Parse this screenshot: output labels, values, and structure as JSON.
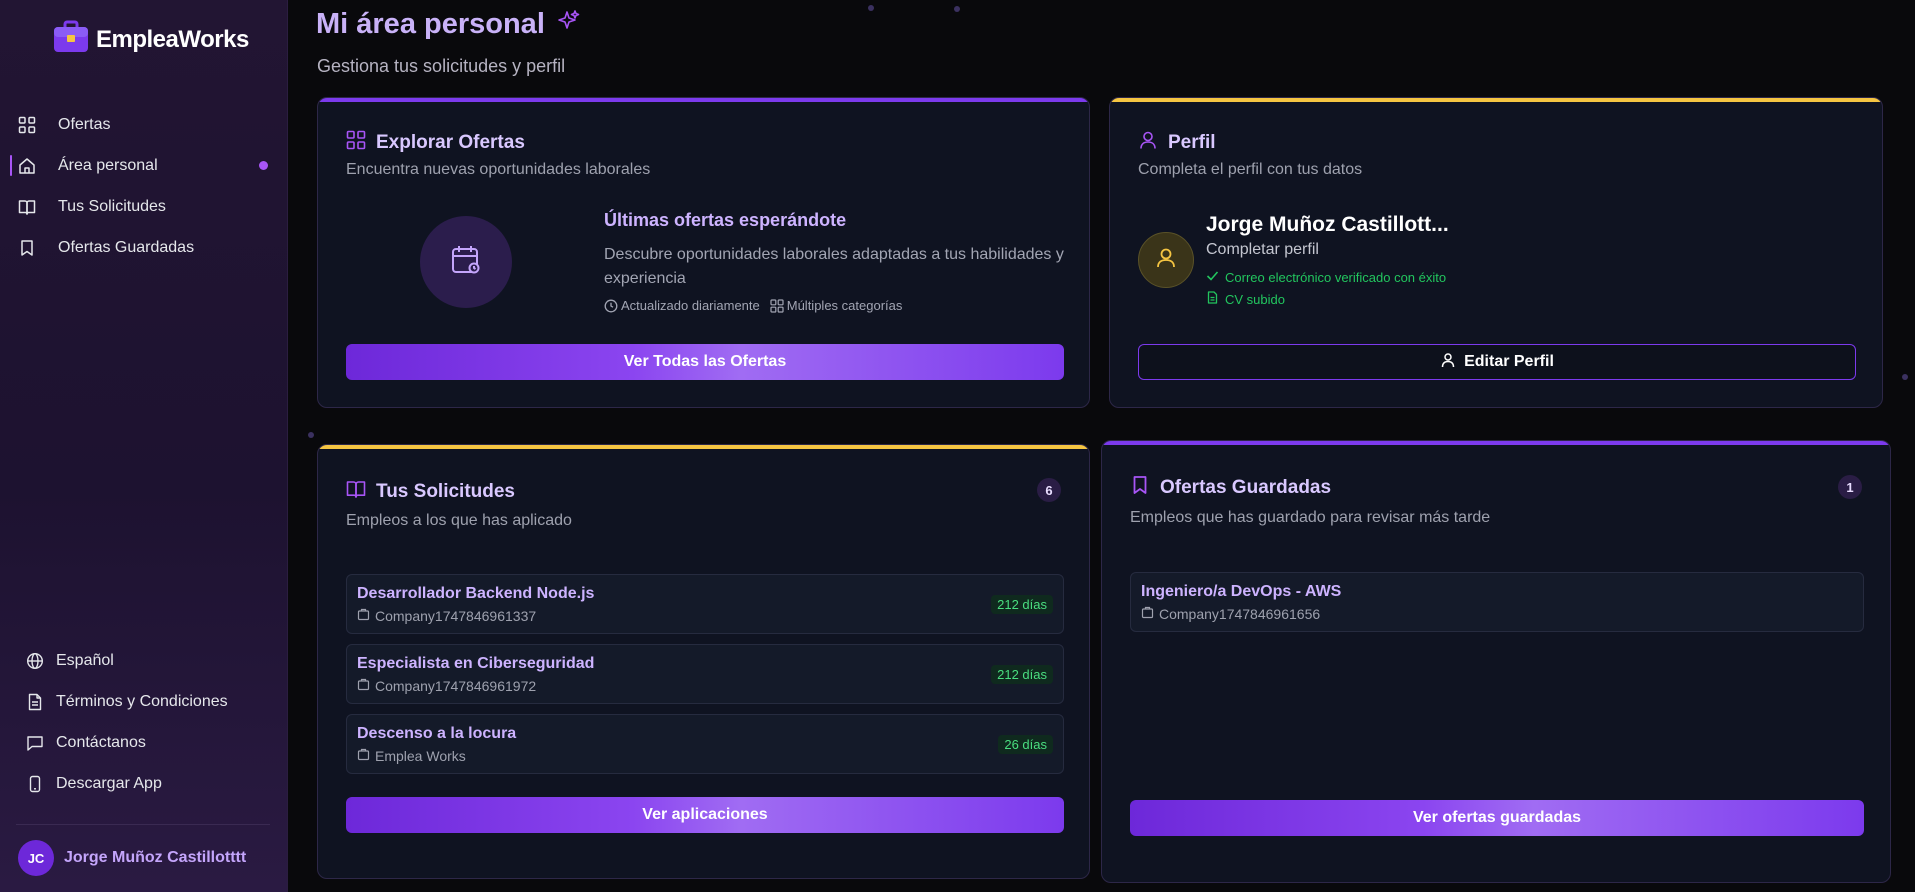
{
  "app": {
    "name": "EmpleaWorks"
  },
  "sidebar": {
    "items": [
      {
        "label": "Ofertas",
        "icon": "grid-icon",
        "active": false
      },
      {
        "label": "Área personal",
        "icon": "home-icon",
        "active": true
      },
      {
        "label": "Tus Solicitudes",
        "icon": "book-icon",
        "active": false
      },
      {
        "label": "Ofertas Guardadas",
        "icon": "bookmark-icon",
        "active": false
      }
    ],
    "bottom": [
      {
        "label": "Español",
        "icon": "globe-icon"
      },
      {
        "label": "Términos y Condiciones",
        "icon": "document-icon"
      },
      {
        "label": "Contáctanos",
        "icon": "chat-icon"
      },
      {
        "label": "Descargar App",
        "icon": "phone-icon"
      }
    ],
    "user": {
      "initials": "JC",
      "name": "Jorge Muñoz Castillotttt"
    }
  },
  "header": {
    "title": "Mi área personal",
    "subtitle": "Gestiona tus solicitudes y perfil"
  },
  "explore": {
    "title": "Explorar Ofertas",
    "subtitle": "Encuentra nuevas oportunidades laborales",
    "heading": "Últimas ofertas esperándote",
    "description": "Descubre oportunidades laborales adaptadas a tus habilidades y experiencia",
    "meta": [
      "Actualizado diariamente",
      "Múltiples categorías"
    ],
    "button": "Ver Todas las Ofertas"
  },
  "profile": {
    "title": "Perfil",
    "subtitle": "Completa el perfil con tus datos",
    "name": "Jorge Muñoz Castillott...",
    "action": "Completar perfil",
    "checks": [
      "Correo electrónico verificado con éxito",
      "CV subido"
    ],
    "button": "Editar Perfil"
  },
  "applications": {
    "title": "Tus Solicitudes",
    "subtitle": "Empleos a los que has aplicado",
    "count": "6",
    "items": [
      {
        "title": "Desarrollador Backend Node.js",
        "company": "Company1747846961337",
        "age": "212 días"
      },
      {
        "title": "Especialista en Ciberseguridad",
        "company": "Company1747846961972",
        "age": "212 días"
      },
      {
        "title": "Descenso a la locura",
        "company": "Emplea Works",
        "age": "26 días"
      }
    ],
    "button": "Ver aplicaciones"
  },
  "saved": {
    "title": "Ofertas Guardadas",
    "subtitle": "Empleos que has guardado para revisar más tarde",
    "count": "1",
    "items": [
      {
        "title": "Ingeniero/a DevOps - AWS",
        "company": "Company1747846961656"
      }
    ],
    "button": "Ver ofertas guardadas"
  },
  "colors": {
    "accent": "#7c3aed",
    "highlight": "#f5c542",
    "success": "#22c55e",
    "background": "#09090c"
  }
}
